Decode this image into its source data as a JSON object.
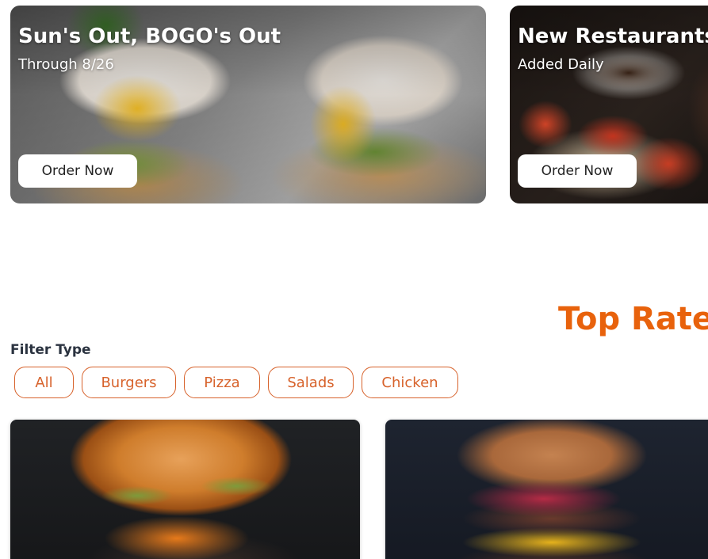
{
  "promos": [
    {
      "title": "Sun's Out, BOGO's Out",
      "subtitle": "Through 8/26",
      "button_label": "Order Now",
      "image": "poached-eggs-avocado-toast-image"
    },
    {
      "title": "New Restaurants",
      "subtitle": "Added Daily",
      "button_label": "Order Now",
      "image": "steak-tomatoes-sauce-image"
    }
  ],
  "section": {
    "title": "Top Rated"
  },
  "filters": {
    "label": "Filter Type",
    "options": [
      "All",
      "Burgers",
      "Pizza",
      "Salads",
      "Chicken"
    ]
  },
  "food_cards": [
    {
      "image": "cheeseburger-image"
    },
    {
      "image": "pastrami-burger-image"
    }
  ],
  "colors": {
    "accent": "#e8620c",
    "chip_border": "#d7622b",
    "label_text": "#2b3340",
    "button_bg": "#ffffff"
  }
}
